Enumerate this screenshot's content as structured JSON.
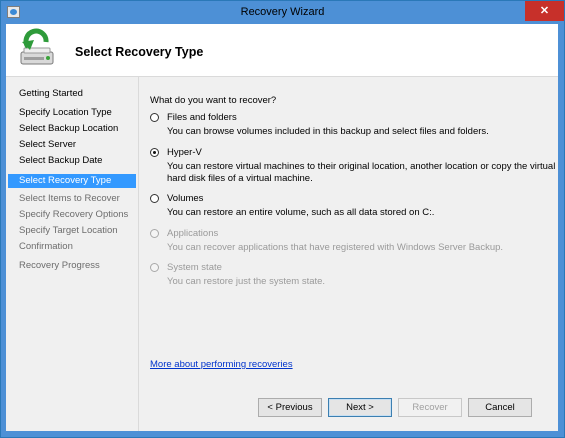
{
  "window": {
    "title": "Recovery Wizard",
    "close_glyph": "✕"
  },
  "header": {
    "title": "Select Recovery Type",
    "icon": "backup-wizard-icon"
  },
  "steps": [
    {
      "label": "Getting Started",
      "state": "normal"
    },
    {
      "label": "Specify Location Type",
      "state": "normal"
    },
    {
      "label": "Select Backup Location",
      "state": "normal"
    },
    {
      "label": "Select Server",
      "state": "normal"
    },
    {
      "label": "Select Backup Date",
      "state": "normal"
    },
    {
      "label": "Select Recovery Type",
      "state": "active"
    },
    {
      "label": "Select Items to Recover",
      "state": "disabled"
    },
    {
      "label": "Specify Recovery Options",
      "state": "disabled"
    },
    {
      "label": "Specify Target Location",
      "state": "disabled"
    },
    {
      "label": "Confirmation",
      "state": "disabled"
    },
    {
      "label": "Recovery Progress",
      "state": "disabled"
    }
  ],
  "main": {
    "question": "What do you want to recover?",
    "options": [
      {
        "label": "Files and folders",
        "description": "You can browse volumes included in this backup and select files and folders.",
        "selected": false,
        "enabled": true
      },
      {
        "label": "Hyper-V",
        "description": "You can restore virtual machines to their original location, another location or copy the virtual hard disk files of a virtual machine.",
        "selected": true,
        "enabled": true
      },
      {
        "label": "Volumes",
        "description": "You can restore an entire volume, such as all data stored on C:.",
        "selected": false,
        "enabled": true
      },
      {
        "label": "Applications",
        "description": "You can recover applications that have registered with Windows Server Backup.",
        "selected": false,
        "enabled": false
      },
      {
        "label": "System state",
        "description": "You can restore just the system state.",
        "selected": false,
        "enabled": false
      }
    ],
    "link": "More about performing recoveries"
  },
  "buttons": {
    "previous": "< Previous",
    "next": "Next >",
    "recover": "Recover",
    "cancel": "Cancel"
  },
  "colors": {
    "titlebar": "#4d90d6",
    "selection": "#3399ff",
    "close": "#c7302a",
    "link": "#0033cc"
  }
}
